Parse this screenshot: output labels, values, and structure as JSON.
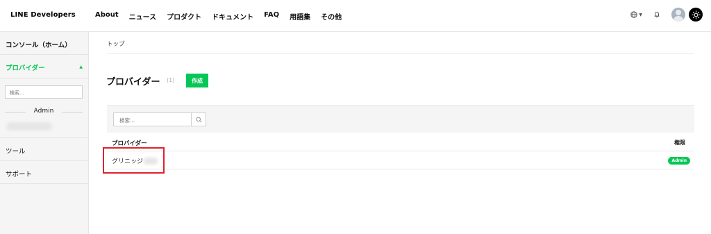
{
  "header": {
    "logo": "LINE Developers",
    "nav": [
      "About",
      "ニュース",
      "プロダクト",
      "ドキュメント",
      "FAQ",
      "用語集",
      "その他"
    ]
  },
  "sidebar": {
    "console_home": "コンソール（ホーム）",
    "provider": "プロバイダー",
    "search_placeholder": "検索...",
    "section_label": "Admin",
    "bottom_items": [
      "ツール",
      "サポート"
    ]
  },
  "main": {
    "breadcrumb": "トップ",
    "title": "プロバイダー",
    "count": "(1)",
    "create_label": "作成",
    "search_placeholder": "検索...",
    "table": {
      "headers": {
        "name": "プロバイダー",
        "permission": "権限"
      },
      "rows": [
        {
          "name": "グリニッジ",
          "badge": "Admin"
        }
      ]
    }
  },
  "colors": {
    "accent": "#06c755",
    "highlight": "#e0202b"
  }
}
